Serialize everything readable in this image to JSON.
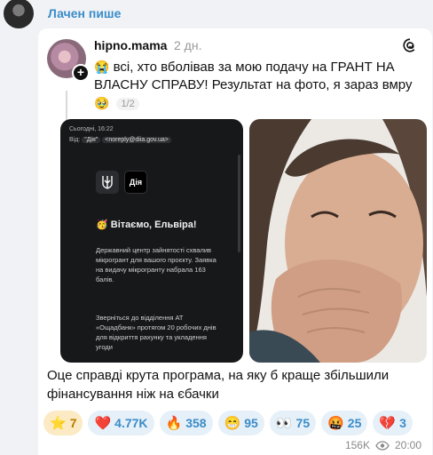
{
  "channel": {
    "sender": "Лачен пише"
  },
  "post": {
    "username": "hipno.mama",
    "age": "2 дн.",
    "text_emoji": "😭",
    "text": "всі, хто вболівав за мою подачу на ГРАНТ НА ВЛАСНУ СПРАВУ! Результат на фото, я зараз вмру",
    "under_emoji": "🥹",
    "page_counter": "1/2"
  },
  "screenshot": {
    "date": "Сьогодні, 16:22",
    "from_label": "Від:",
    "from_name": "\"Дія\"",
    "from_email": "<noreply@diia.gov.ua>",
    "logo_text": "Дія",
    "greeting": "🥳 Вітаємо, Ельвіра!",
    "body1": "Державний центр зайнятості схвалив мікрогрант для вашого проєкту. Заявка на видачу мікрогранту набрала 163 балів.",
    "body2": "Зверніться до відділення АТ «Ощадбанк» протягом 20 робочих днів для відкриття рахунку та укладення угоди"
  },
  "caption": "Оце справді крута програма, на яку б краще збільшили фінансування ніж на єбачки",
  "reactions": [
    {
      "emoji": "⭐",
      "count": "7"
    },
    {
      "emoji": "❤️",
      "count": "4.77K"
    },
    {
      "emoji": "🔥",
      "count": "358"
    },
    {
      "emoji": "😁",
      "count": "95"
    },
    {
      "emoji": "👀",
      "count": "75"
    },
    {
      "emoji": "🤬",
      "count": "25"
    },
    {
      "emoji": "💔",
      "count": "3"
    }
  ],
  "meta": {
    "views": "156K",
    "time": "20:00"
  }
}
